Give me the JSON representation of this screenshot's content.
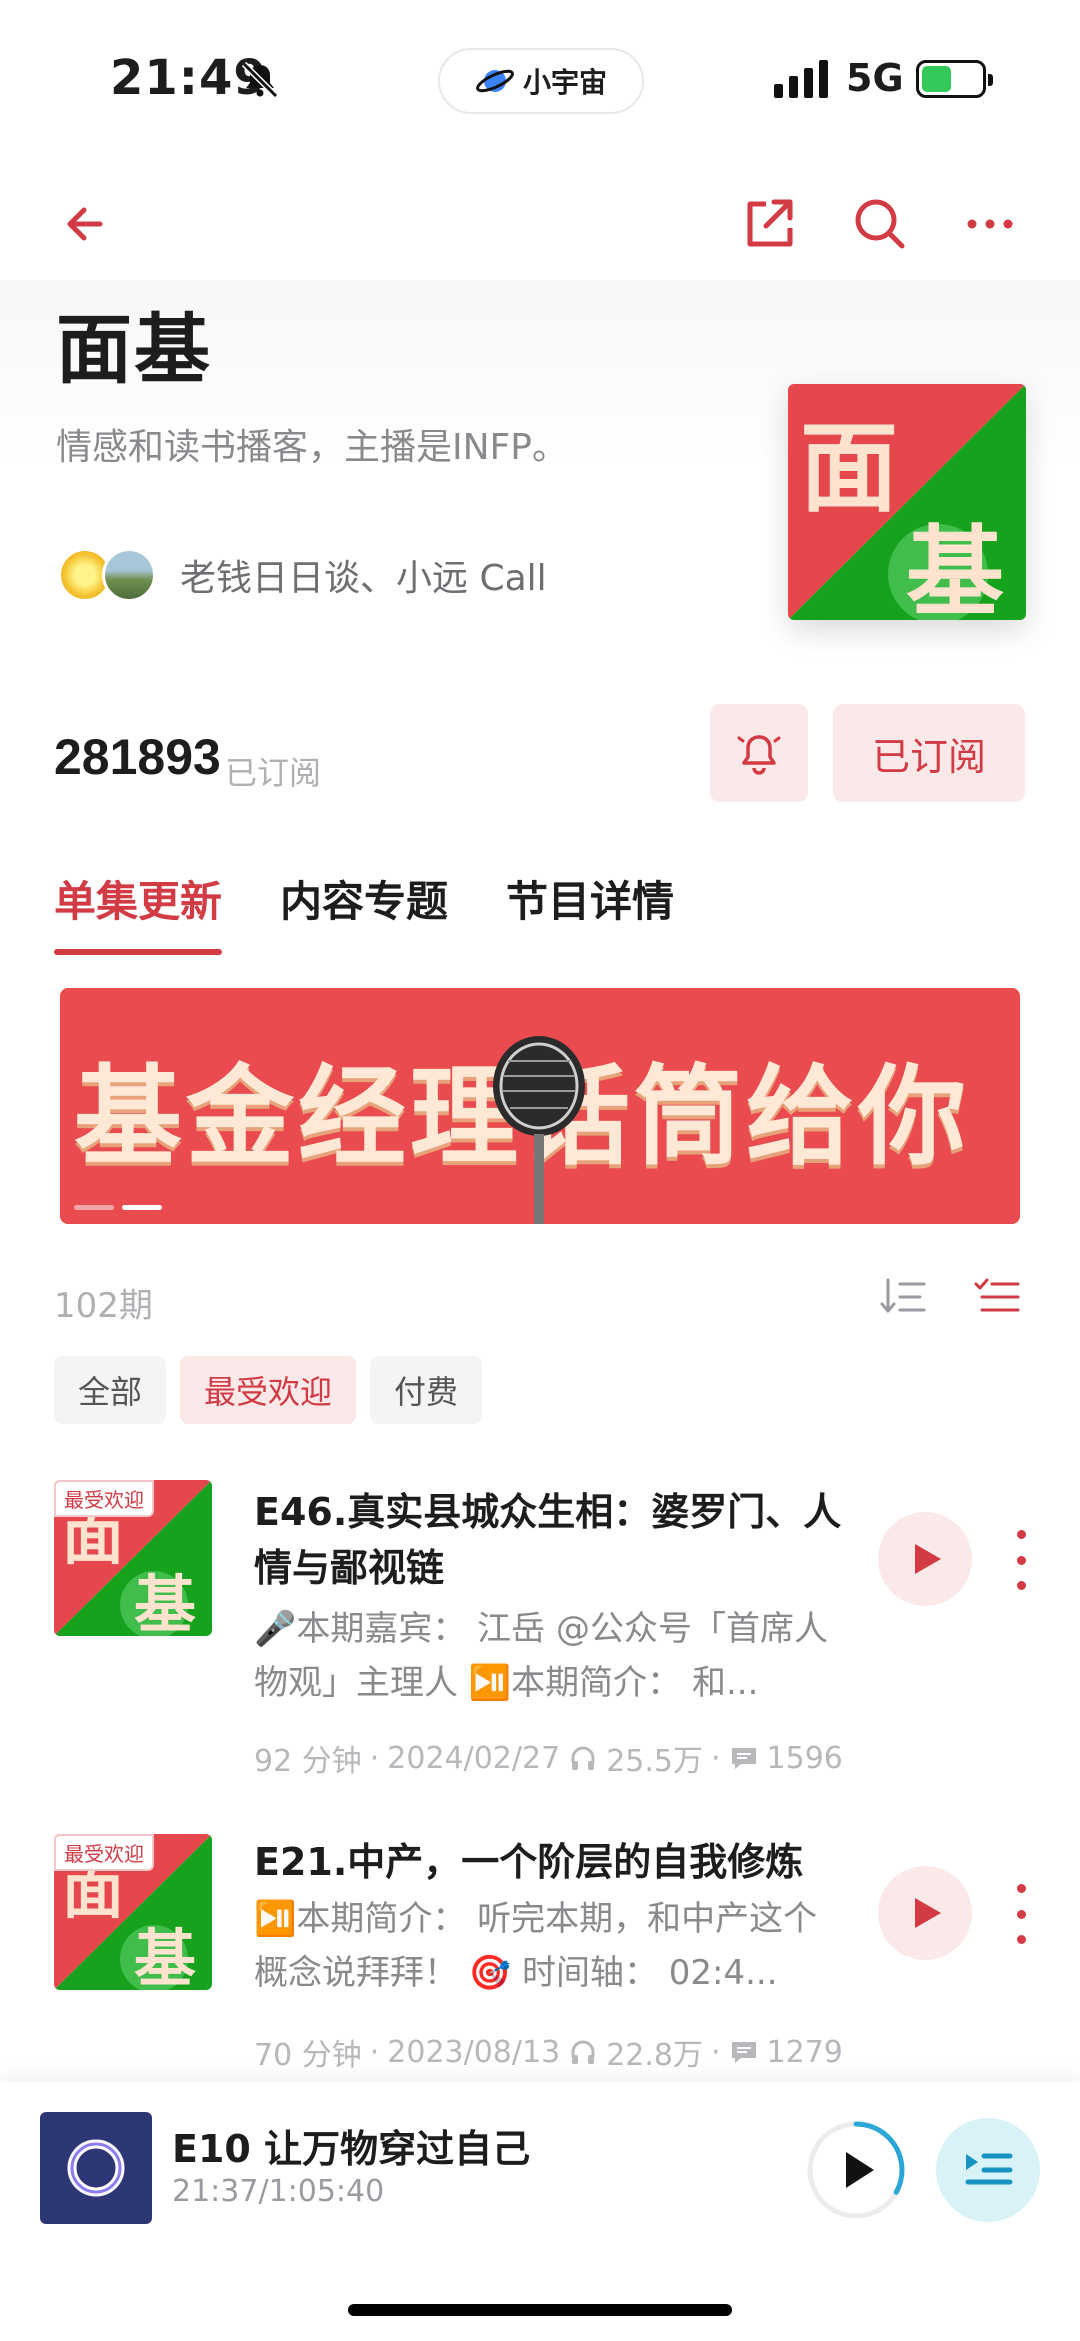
{
  "status_bar": {
    "time": "21:49",
    "pill_label": "小宇宙",
    "network": "5G"
  },
  "show": {
    "title": "面基",
    "description": "情感和读书播客，主播是INFP。",
    "hosts": "老钱日日谈、小远 Call",
    "cover_text_top": "面",
    "cover_text_bottom": "基",
    "subscriber_count": "281893",
    "subscriber_label": "已订阅",
    "subscribe_button": "已订阅"
  },
  "tabs": [
    {
      "label": "单集更新",
      "active": true
    },
    {
      "label": "内容专题",
      "active": false
    },
    {
      "label": "节目详情",
      "active": false
    }
  ],
  "banner": {
    "text": "基金经理话筒给你"
  },
  "episode_count": "102期",
  "chips": [
    {
      "label": "全部",
      "active": false
    },
    {
      "label": "最受欢迎",
      "active": true
    },
    {
      "label": "付费",
      "active": false
    }
  ],
  "episodes": [
    {
      "tag": "最受欢迎",
      "title": "E46.真实县城众生相：婆罗门、人情与鄙视链",
      "desc": "🎤本期嘉宾： 江岳 @公众号「首席人物观」主理人 ⏯️本期简介： 和...",
      "duration": "92 分钟",
      "date": "2024/02/27",
      "plays": "25.5万",
      "comments": "1596"
    },
    {
      "tag": "最受欢迎",
      "title": "E21.中产，一个阶层的自我修炼",
      "desc": "⏯️本期简介： 听完本期，和中产这个概念说拜拜！ 🎯 时间轴： 02:4...",
      "duration": "70 分钟",
      "date": "2023/08/13",
      "plays": "22.8万",
      "comments": "1279"
    }
  ],
  "mini_player": {
    "title": "E10 让万物穿过自己",
    "time": "21:37/1:05:40",
    "progress": 0.33
  },
  "colors": {
    "accent": "#d23a44",
    "accent_soft": "#fbe9ea",
    "cover_red": "#e5474d",
    "cover_green": "#16a21c"
  }
}
